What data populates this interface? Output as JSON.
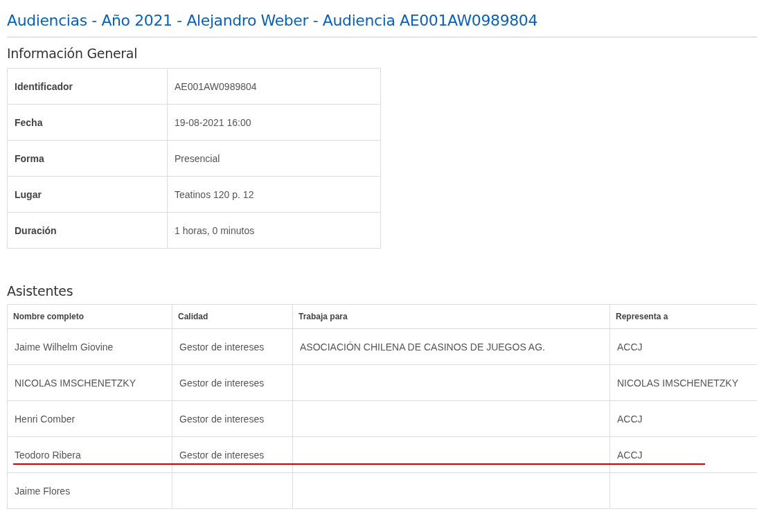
{
  "title": "Audiencias - Año 2021 - Alejandro Weber - Audiencia AE001AW0989804",
  "general": {
    "heading": "Información General",
    "rows": [
      {
        "label": "Identificador",
        "value": "AE001AW0989804"
      },
      {
        "label": "Fecha",
        "value": "19-08-2021 16:00"
      },
      {
        "label": "Forma",
        "value": "Presencial"
      },
      {
        "label": "Lugar",
        "value": "Teatinos 120 p. 12"
      },
      {
        "label": "Duración",
        "value": "1 horas, 0 minutos"
      }
    ]
  },
  "attendees": {
    "heading": "Asistentes",
    "columns": [
      "Nombre completo",
      "Calidad",
      "Trabaja para",
      "Representa a"
    ],
    "rows": [
      {
        "cells": [
          "Jaime Wilhelm Giovine",
          "Gestor de intereses",
          "ASOCIACIÓN CHILENA DE CASINOS DE JUEGOS AG.",
          "ACCJ"
        ],
        "marked": false
      },
      {
        "cells": [
          "NICOLAS IMSCHENETZKY",
          "Gestor de intereses",
          "",
          "NICOLAS IMSCHENETZKY"
        ],
        "marked": false
      },
      {
        "cells": [
          "Henri Comber",
          "Gestor de intereses",
          "",
          "ACCJ"
        ],
        "marked": false
      },
      {
        "cells": [
          "Teodoro Ribera",
          "Gestor de intereses",
          "",
          "ACCJ"
        ],
        "marked": true
      },
      {
        "cells": [
          "Jaime Flores",
          "",
          "",
          ""
        ],
        "marked": false
      }
    ]
  }
}
